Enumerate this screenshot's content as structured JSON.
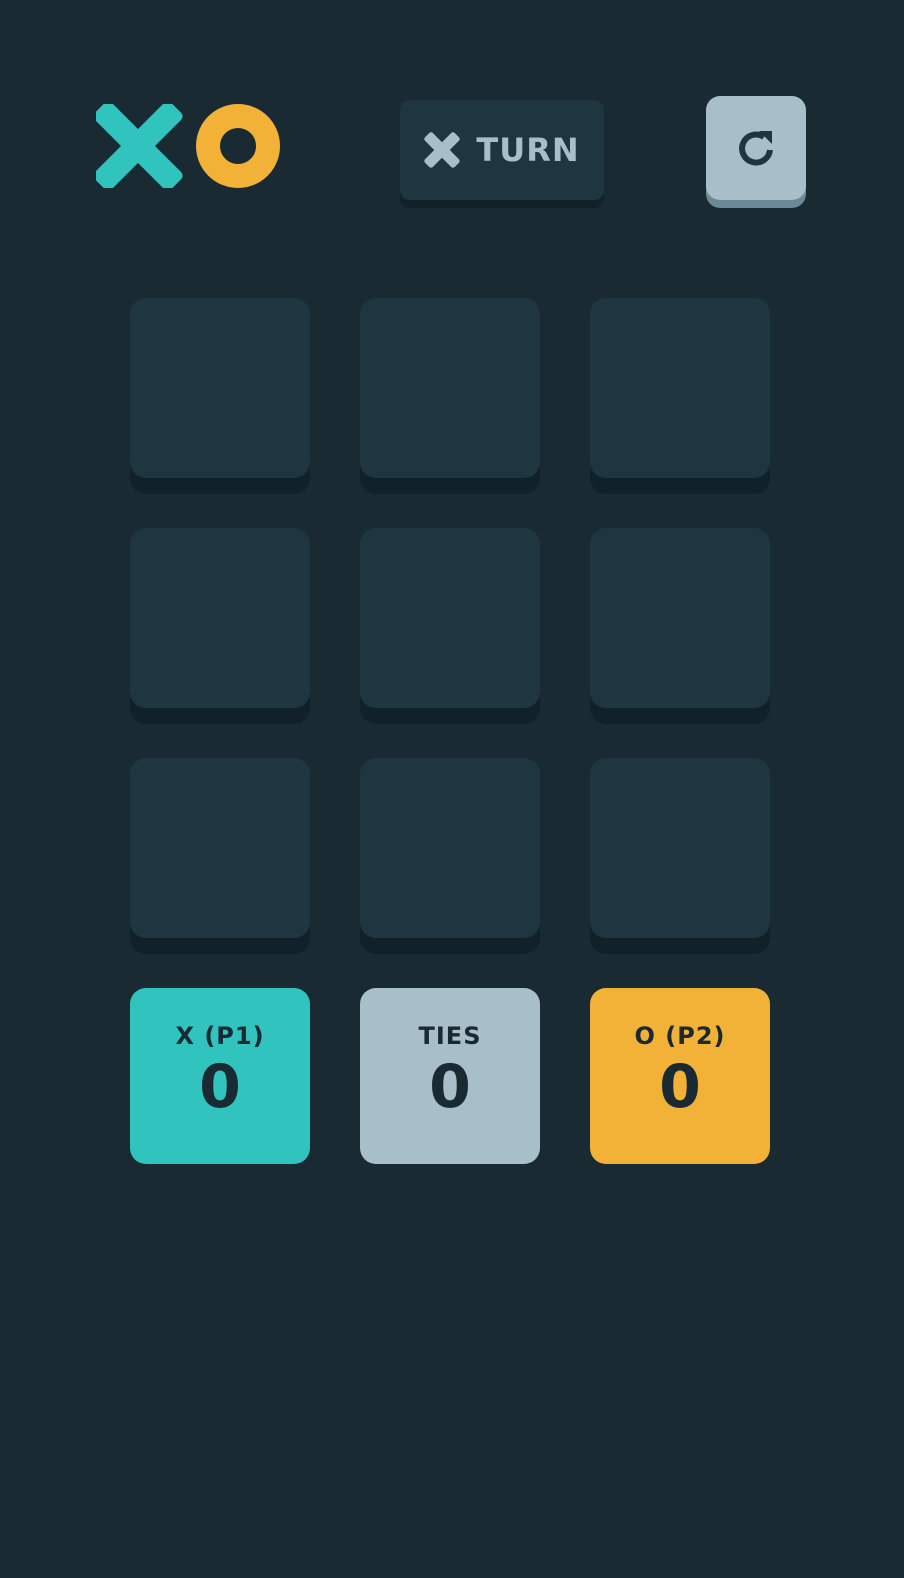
{
  "header": {
    "logo": {
      "x_icon": "x-mark-icon",
      "o_icon": "o-ring-icon",
      "x_color": "#31c3bd",
      "o_color": "#f2b137"
    },
    "turn": {
      "icon": "x-mark-icon",
      "label": "TURN"
    },
    "restart": {
      "icon": "restart-icon"
    }
  },
  "board": {
    "cells": [
      "",
      "",
      "",
      "",
      "",
      "",
      "",
      "",
      ""
    ]
  },
  "scores": {
    "x": {
      "label": "X (P1)",
      "value": "0",
      "color": "#31c3bd"
    },
    "ties": {
      "label": "TIES",
      "value": "0",
      "color": "#a8bfc9"
    },
    "o": {
      "label": "O (P2)",
      "value": "0",
      "color": "#f2b137"
    }
  },
  "colors": {
    "background": "#1a2a32",
    "tile": "#1f3641",
    "tile_shadow": "#10212a",
    "silver": "#a8bfc9",
    "dark_text": "#1a2a33"
  }
}
